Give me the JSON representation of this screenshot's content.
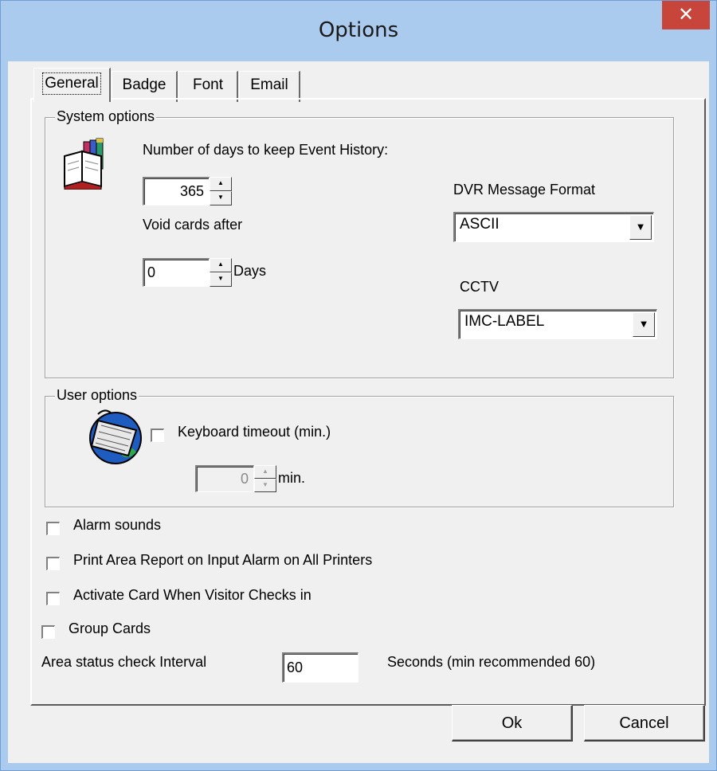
{
  "window": {
    "title": "Options",
    "close": "✕"
  },
  "tabs": [
    {
      "label": "General",
      "active": true
    },
    {
      "label": "Badge"
    },
    {
      "label": "Font"
    },
    {
      "label": "Email"
    }
  ],
  "system_options": {
    "title": "System options",
    "history_label": "Number of days to keep Event History:",
    "history_value": "365",
    "void_label": "Void cards after",
    "void_value": "0",
    "void_unit": "Days",
    "dvr_label": "DVR Message Format",
    "dvr_value": "ASCII",
    "cctv_label": "CCTV",
    "cctv_value": "IMC-LABEL"
  },
  "user_options": {
    "title": "User options",
    "keyboard_timeout_label": "Keyboard timeout (min.)",
    "timeout_value": "0",
    "timeout_unit": "min."
  },
  "checks": {
    "alarm_sounds": "Alarm sounds",
    "print_area_report": "Print Area Report on Input Alarm on All Printers",
    "activate_card": "Activate Card When Visitor Checks in",
    "group_cards": "Group Cards"
  },
  "area_status": {
    "label": "Area status check Interval",
    "value": "60",
    "hint": "Seconds (min recommended 60)"
  },
  "buttons": {
    "ok": "Ok",
    "cancel": "Cancel"
  },
  "icons": {
    "book": "book-icon",
    "keyboard_globe": "keyboard-globe-icon"
  }
}
